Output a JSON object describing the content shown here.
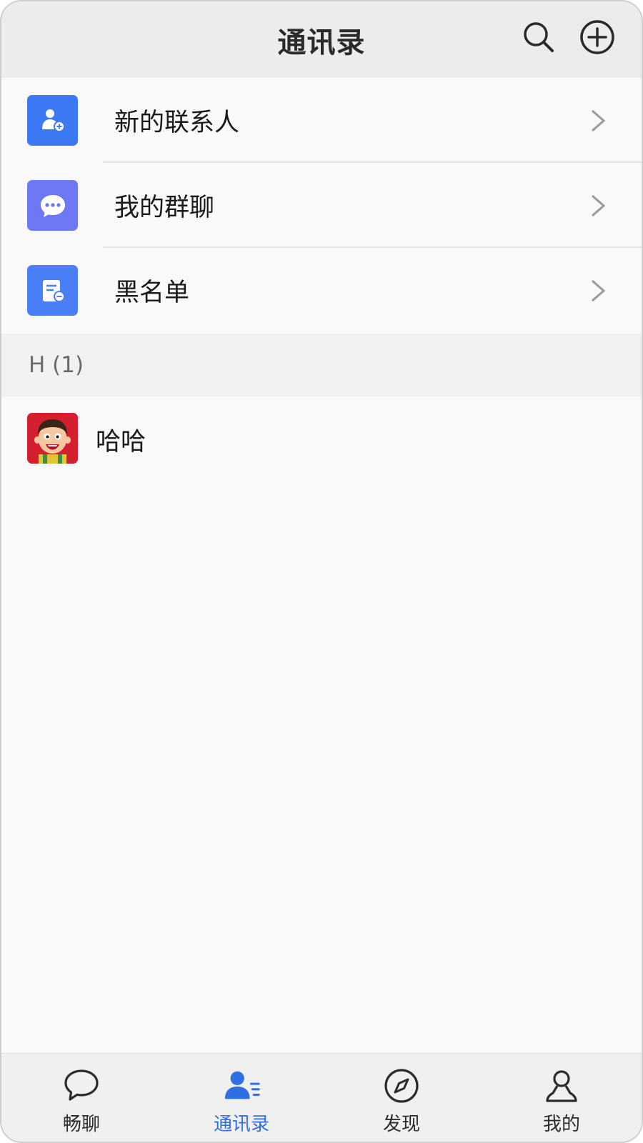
{
  "header": {
    "title": "通讯录",
    "search_icon": "search-icon",
    "add_icon": "plus-circle-icon"
  },
  "menu": {
    "items": [
      {
        "label": "新的联系人",
        "icon": "add-contact-icon",
        "color": "#3d79f5"
      },
      {
        "label": "我的群聊",
        "icon": "chat-bubble-icon",
        "color": "#6e78f5"
      },
      {
        "label": "黑名单",
        "icon": "blacklist-icon",
        "color": "#4a80f7"
      }
    ]
  },
  "contacts": {
    "section_label": "H (1)",
    "items": [
      {
        "name": "哈哈",
        "avatar": "cartoon-boy-avatar"
      }
    ]
  },
  "tabbar": {
    "active_color": "#2f6fe6",
    "tabs": [
      {
        "label": "畅聊",
        "icon": "chat-icon",
        "active": false
      },
      {
        "label": "通讯录",
        "icon": "contacts-icon",
        "active": true
      },
      {
        "label": "发现",
        "icon": "compass-icon",
        "active": false
      },
      {
        "label": "我的",
        "icon": "user-icon",
        "active": false
      }
    ]
  }
}
